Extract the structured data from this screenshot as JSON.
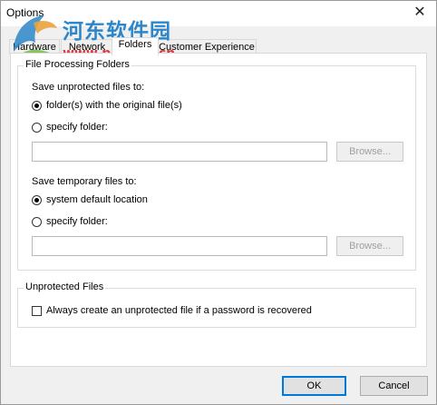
{
  "window": {
    "title": "Options",
    "close_glyph": "✕"
  },
  "watermark": {
    "cn": "河东软件园",
    "url": "www.pc0359.cn"
  },
  "tabs": [
    "Hardware",
    "Network",
    "Folders",
    "Customer Experience"
  ],
  "active_tab": "Folders",
  "file_processing": {
    "group_label": "File Processing Folders",
    "unprotected": {
      "label": "Save unprotected files to:",
      "option_original": "folder(s) with the original file(s)",
      "option_specify": "specify folder:",
      "selected": "original",
      "path_value": "",
      "browse_label": "Browse..."
    },
    "temporary": {
      "label": "Save temporary files to:",
      "option_default": "system default location",
      "option_specify": "specify folder:",
      "selected": "default",
      "path_value": "",
      "browse_label": "Browse..."
    }
  },
  "unprotected_files": {
    "group_label": "Unprotected Files",
    "checkbox_label": "Always create an unprotected file if a password is recovered",
    "checked": false
  },
  "buttons": {
    "ok": "OK",
    "cancel": "Cancel"
  },
  "colors": {
    "accent": "#0078d7",
    "watermark_cn": "#2d86c9",
    "watermark_url": "#e03a3a"
  }
}
